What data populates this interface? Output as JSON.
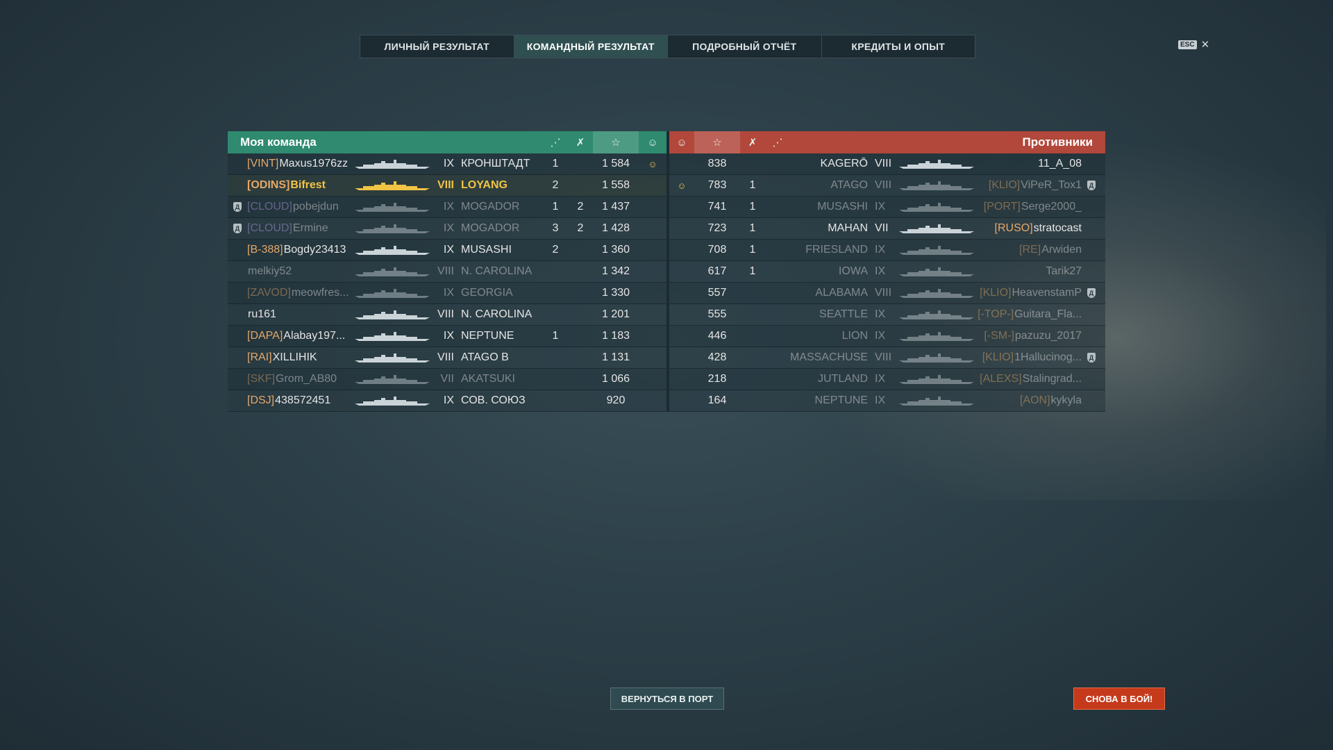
{
  "tabs": [
    "ЛИЧНЫЙ РЕЗУЛЬТАТ",
    "КОМАНДНЫЙ РЕЗУЛЬТАТ",
    "ПОДРОБНЫЙ ОТЧЁТ",
    "КРЕДИТЫ И ОПЫТ"
  ],
  "active_tab": 1,
  "esc": {
    "key": "ESC",
    "close": "✕"
  },
  "my_team": {
    "title": "Моя команда"
  },
  "enemy_team": {
    "title": "Противники"
  },
  "header_icons": [
    "ship-kills-icon",
    "plane-kills-icon",
    "experience-star-icon",
    "mvp-icon"
  ],
  "icons": {
    "star": "☆",
    "kills": "✗",
    "planes": "⋰",
    "mvp": "☺",
    "division": "Д"
  },
  "colors": {
    "my_team": "#2f8a6f",
    "enemy_team": "#b2473b",
    "player": "#f2c445",
    "clan": "#e6a96a",
    "clan_cloud": "#b5a0e8"
  },
  "my_rows": [
    {
      "div": false,
      "clan": "[VINT]",
      "name": "Maxus1976zz",
      "tier": "IX",
      "ship": "КРОНШТАДТ",
      "ships": "1",
      "planes": "",
      "exp": "1 584",
      "mvp": true,
      "dim": false,
      "me": false
    },
    {
      "div": false,
      "clan": "[ODINS]",
      "name": "Bifrest",
      "tier": "VIII",
      "ship": "LOYANG",
      "ships": "2",
      "planes": "",
      "exp": "1 558",
      "mvp": false,
      "dim": false,
      "me": true
    },
    {
      "div": true,
      "clan": "[CLOUD]",
      "name": "pobejdun",
      "tier": "IX",
      "ship": "MOGADOR",
      "ships": "1",
      "planes": "2",
      "exp": "1 437",
      "mvp": false,
      "dim": true,
      "me": false
    },
    {
      "div": true,
      "clan": "[CLOUD]",
      "name": "Ermine",
      "tier": "IX",
      "ship": "MOGADOR",
      "ships": "3",
      "planes": "2",
      "exp": "1 428",
      "mvp": false,
      "dim": true,
      "me": false
    },
    {
      "div": false,
      "clan": "[B-388]",
      "name": "Bogdy23413",
      "tier": "IX",
      "ship": "MUSASHI",
      "ships": "2",
      "planes": "",
      "exp": "1 360",
      "mvp": false,
      "dim": false,
      "me": false
    },
    {
      "div": false,
      "clan": "",
      "name": "melkiy52",
      "tier": "VIII",
      "ship": "N. CAROLINA",
      "ships": "",
      "planes": "",
      "exp": "1 342",
      "mvp": false,
      "dim": true,
      "me": false
    },
    {
      "div": false,
      "clan": "[ZAVOD]",
      "name": "meowfres...",
      "tier": "IX",
      "ship": "GEORGIA",
      "ships": "",
      "planes": "",
      "exp": "1 330",
      "mvp": false,
      "dim": true,
      "me": false
    },
    {
      "div": false,
      "clan": "",
      "name": "ru161",
      "tier": "VIII",
      "ship": "N. CAROLINA",
      "ships": "",
      "planes": "",
      "exp": "1 201",
      "mvp": false,
      "dim": false,
      "me": false
    },
    {
      "div": false,
      "clan": "[DAPA]",
      "name": "Alabay197...",
      "tier": "IX",
      "ship": "NEPTUNE",
      "ships": "1",
      "planes": "",
      "exp": "1 183",
      "mvp": false,
      "dim": false,
      "me": false
    },
    {
      "div": false,
      "clan": "[RAI]",
      "name": "XILLIHIK",
      "tier": "VIII",
      "ship": "ATAGO B",
      "ships": "",
      "planes": "",
      "exp": "1 131",
      "mvp": false,
      "dim": false,
      "me": false
    },
    {
      "div": false,
      "clan": "[SKF]",
      "name": "Grom_AB80",
      "tier": "VII",
      "ship": "AKATSUKI",
      "ships": "",
      "planes": "",
      "exp": "1 066",
      "mvp": false,
      "dim": true,
      "me": false
    },
    {
      "div": false,
      "clan": "[DSJ]",
      "name": "438572451",
      "tier": "IX",
      "ship": "СОВ. СОЮЗ",
      "ships": "",
      "planes": "",
      "exp": "920",
      "mvp": false,
      "dim": false,
      "me": false
    }
  ],
  "enemy_rows": [
    {
      "mvp": false,
      "exp": "838",
      "ships": "",
      "ship": "KAGERŌ",
      "tier": "VIII",
      "clan": "",
      "name": "11_A_08",
      "div": false,
      "dim": false
    },
    {
      "mvp": true,
      "exp": "783",
      "ships": "1",
      "ship": "ATAGO",
      "tier": "VIII",
      "clan": "[KLIO]",
      "name": "ViPeR_Tox1",
      "div": true,
      "dim": true
    },
    {
      "mvp": false,
      "exp": "741",
      "ships": "1",
      "ship": "MUSASHI",
      "tier": "IX",
      "clan": "[PORT]",
      "name": "Serge2000_",
      "div": false,
      "dim": true
    },
    {
      "mvp": false,
      "exp": "723",
      "ships": "1",
      "ship": "MAHAN",
      "tier": "VII",
      "clan": "[RUSO]",
      "name": "stratocast",
      "div": false,
      "dim": false
    },
    {
      "mvp": false,
      "exp": "708",
      "ships": "1",
      "ship": "FRIESLAND",
      "tier": "IX",
      "clan": "[RE]",
      "name": "Arwiden",
      "div": false,
      "dim": true
    },
    {
      "mvp": false,
      "exp": "617",
      "ships": "1",
      "ship": "IOWA",
      "tier": "IX",
      "clan": "",
      "name": "Tarik27",
      "div": false,
      "dim": true
    },
    {
      "mvp": false,
      "exp": "557",
      "ships": "",
      "ship": "ALABAMA",
      "tier": "VIII",
      "clan": "[KLIO]",
      "name": "HeavenstamP",
      "div": true,
      "dim": true
    },
    {
      "mvp": false,
      "exp": "555",
      "ships": "",
      "ship": "SEATTLE",
      "tier": "IX",
      "clan": "[-TOP-]",
      "name": "Guitara_Fla...",
      "div": false,
      "dim": true
    },
    {
      "mvp": false,
      "exp": "446",
      "ships": "",
      "ship": "LION",
      "tier": "IX",
      "clan": "[-SM-]",
      "name": "pazuzu_2017",
      "div": false,
      "dim": true
    },
    {
      "mvp": false,
      "exp": "428",
      "ships": "",
      "ship": "MASSACHUSE...",
      "tier": "VIII",
      "clan": "[KLIO]",
      "name": "1Hallucinog...",
      "div": true,
      "dim": true
    },
    {
      "mvp": false,
      "exp": "218",
      "ships": "",
      "ship": "JUTLAND",
      "tier": "IX",
      "clan": "[ALEXS]",
      "name": "Stalingrad...",
      "div": false,
      "dim": true
    },
    {
      "mvp": false,
      "exp": "164",
      "ships": "",
      "ship": "NEPTUNE",
      "tier": "IX",
      "clan": "[AON]",
      "name": "kykyla",
      "div": false,
      "dim": true
    }
  ],
  "buttons": {
    "port": "ВЕРНУТЬСЯ В ПОРТ",
    "battle": "СНОВА В БОЙ!"
  }
}
